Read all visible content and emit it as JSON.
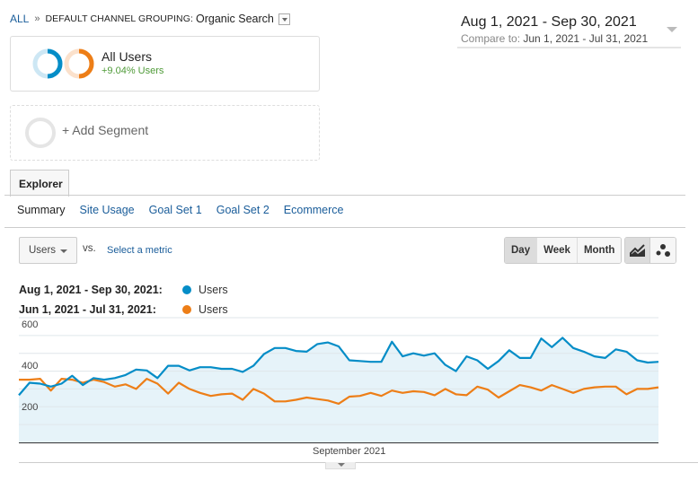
{
  "breadcrumb": {
    "root": "ALL",
    "separator": "»",
    "dimension_label": "DEFAULT CHANNEL GROUPING:",
    "dimension_value": "Organic Search",
    "dropdown_icon": "caret-down-icon"
  },
  "date_range": {
    "primary": "Aug 1, 2021 - Sep 30, 2021",
    "compare_label": "Compare to:",
    "compare_value": "Jun 1, 2021 - Jul 31, 2021",
    "caret_icon": "caret-down-icon"
  },
  "segments": [
    {
      "title": "All Users",
      "subtitle": "+9.04% Users",
      "ring_colors": [
        "#058dc7",
        "#ed7e17"
      ]
    }
  ],
  "add_segment": {
    "label": "+ Add Segment"
  },
  "tabs": {
    "main": [
      {
        "label": "Explorer",
        "active": true
      }
    ],
    "sub": [
      {
        "label": "Summary",
        "active": true
      },
      {
        "label": "Site Usage",
        "active": false
      },
      {
        "label": "Goal Set 1",
        "active": false
      },
      {
        "label": "Goal Set 2",
        "active": false
      },
      {
        "label": "Ecommerce",
        "active": false
      }
    ]
  },
  "controls": {
    "metric_selected": "Users",
    "vs_label": "vs.",
    "select_metric_link": "Select a metric",
    "period_buttons": [
      {
        "label": "Day",
        "active": true
      },
      {
        "label": "Week",
        "active": false
      },
      {
        "label": "Month",
        "active": false
      }
    ],
    "view_buttons": [
      {
        "icon": "line-chart-icon",
        "active": true
      },
      {
        "icon": "motion-chart-icon",
        "active": false
      }
    ]
  },
  "legend": [
    {
      "range": "Aug 1, 2021 - Sep 30, 2021:",
      "metric": "Users",
      "color": "#058dc7"
    },
    {
      "range": "Jun 1, 2021 - Jul 31, 2021:",
      "metric": "Users",
      "color": "#ed7e17"
    }
  ],
  "chart_data": {
    "type": "area",
    "title": "",
    "xlabel": "September 2021",
    "ylabel": "",
    "ylim": [
      0,
      700
    ],
    "yticks": [
      200,
      400,
      600
    ],
    "ytick_labels": [
      "200",
      "400",
      "600"
    ],
    "x_tick_labels": [
      "September 2021"
    ],
    "grid": true,
    "legend_position": "top-left",
    "x_count": 61,
    "series": [
      {
        "name": "Users (Aug 1, 2021 - Sep 30, 2021)",
        "color": "#058dc7",
        "fill": "#e6f3f9",
        "values": [
          265,
          335,
          330,
          313,
          330,
          374,
          322,
          361,
          352,
          361,
          378,
          409,
          404,
          361,
          430,
          430,
          404,
          422,
          422,
          413,
          413,
          396,
          430,
          496,
          530,
          530,
          513,
          509,
          552,
          561,
          539,
          461,
          457,
          452,
          452,
          565,
          483,
          500,
          487,
          500,
          435,
          400,
          483,
          461,
          413,
          457,
          517,
          474,
          474,
          583,
          535,
          587,
          530,
          509,
          483,
          474,
          522,
          509,
          461,
          448,
          452
        ]
      },
      {
        "name": "Users (Jun 1, 2021 - Jul 31, 2021)",
        "color": "#ed7e17",
        "values": [
          352,
          352,
          357,
          291,
          357,
          352,
          335,
          352,
          339,
          313,
          326,
          300,
          357,
          330,
          274,
          335,
          300,
          278,
          261,
          270,
          274,
          239,
          300,
          274,
          230,
          230,
          239,
          252,
          243,
          235,
          217,
          257,
          261,
          278,
          261,
          291,
          278,
          287,
          283,
          265,
          300,
          270,
          265,
          313,
          296,
          252,
          287,
          322,
          309,
          291,
          322,
          300,
          278,
          300,
          309,
          313,
          313,
          270,
          300,
          300,
          309
        ]
      }
    ]
  }
}
